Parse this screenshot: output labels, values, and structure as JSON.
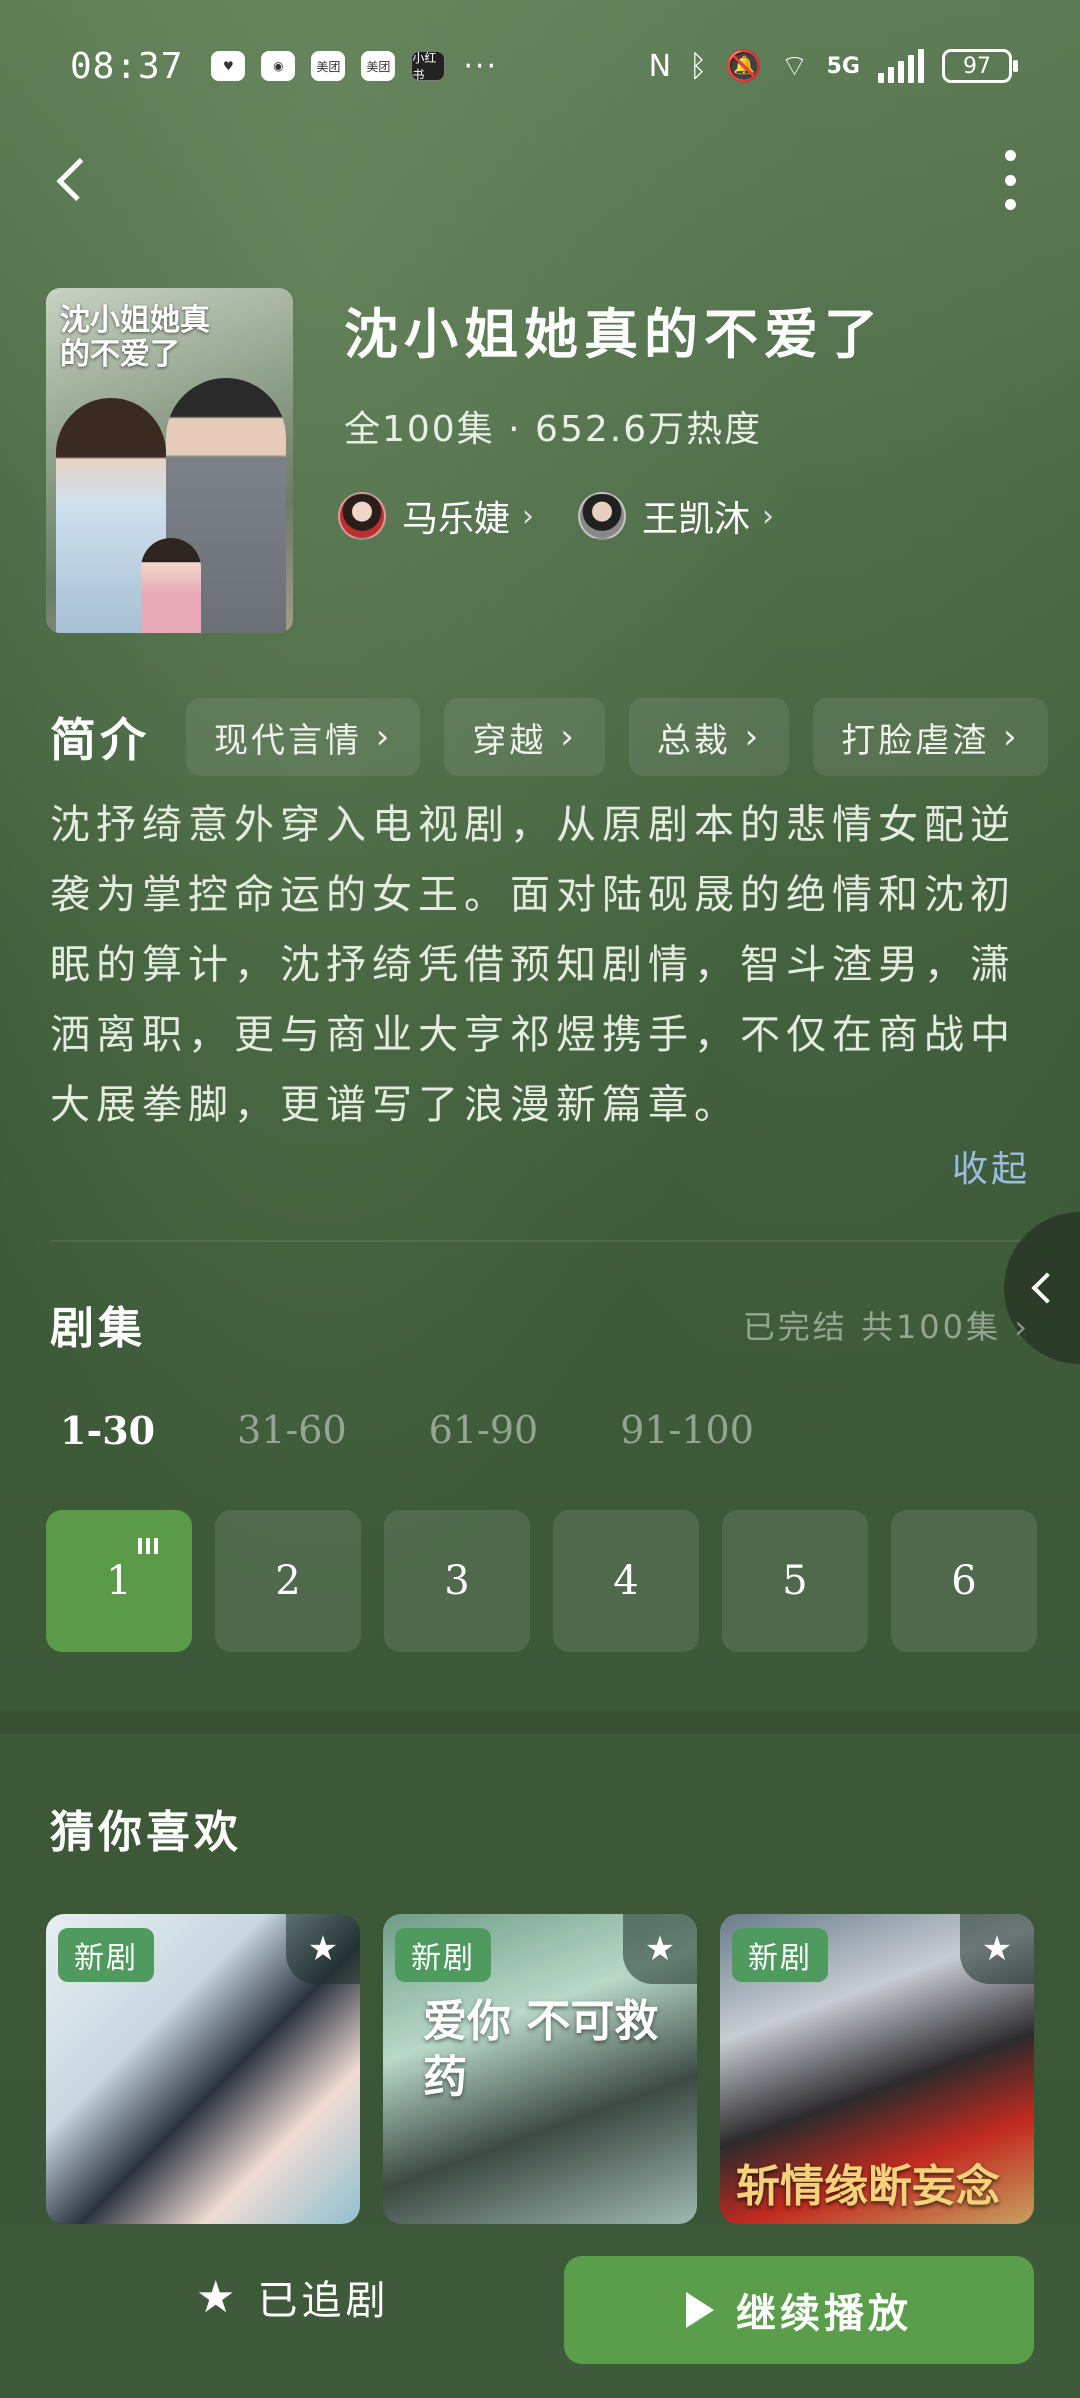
{
  "status_bar": {
    "time": "08:37",
    "apps": [
      "美团",
      "美团",
      "小红书"
    ],
    "more": "···",
    "battery": "97",
    "network": "5G"
  },
  "show": {
    "poster_title": "沈小姐她真的不爱了",
    "title": "沈小姐她真的不爱了",
    "meta": "全100集 · 652.6万热度",
    "cast": [
      {
        "name": "马乐婕"
      },
      {
        "name": "王凯沐"
      }
    ]
  },
  "intro": {
    "label": "简介",
    "tags": [
      "现代言情",
      "穿越",
      "总裁",
      "打脸虐渣"
    ],
    "synopsis": "沈抒绮意外穿入电视剧，从原剧本的悲情女配逆袭为掌控命运的女王。面对陆砚晟的绝情和沈初眠的算计，沈抒绮凭借预知剧情，智斗渣男，潇洒离职，更与商业大亨祁煜携手，不仅在商战中大展拳脚，更谱写了浪漫新篇章。",
    "collapse_label": "收起"
  },
  "episodes": {
    "title": "剧集",
    "status": "已完结 共100集",
    "ranges": [
      "1-30",
      "31-60",
      "61-90",
      "91-100"
    ],
    "items": [
      "1",
      "2",
      "3",
      "4",
      "5",
      "6"
    ]
  },
  "recommend": {
    "title": "猜你喜欢",
    "badge": "新剧",
    "cards": [
      {
        "poster_text": ""
      },
      {
        "poster_text": "爱你 不可救药"
      },
      {
        "poster_text": "斩情缘断妄念"
      }
    ]
  },
  "bottom": {
    "follow_label": "已追剧",
    "play_label": "继续播放"
  },
  "colors": {
    "accent": "#5a9e4c",
    "link": "#9bbde0",
    "background": "#3d5a38"
  }
}
